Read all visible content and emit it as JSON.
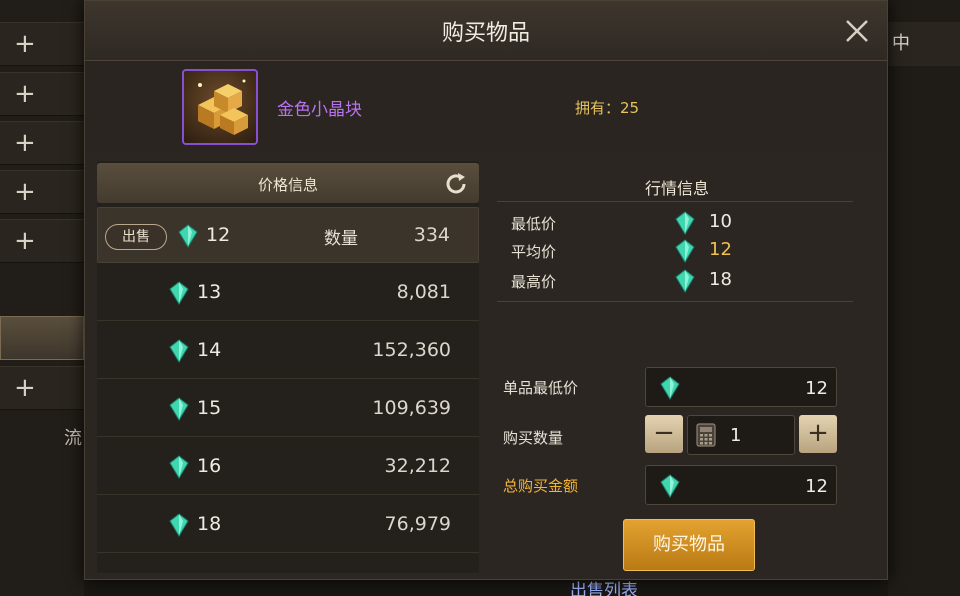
{
  "background": {
    "flow_label": "流",
    "right_tab": "中",
    "bottom_label": "出售列表"
  },
  "dialog": {
    "title": "购买物品",
    "close_icon": "close-icon"
  },
  "item": {
    "name": "金色小晶块",
    "owned": "拥有：25",
    "icon": "gold-crystal-block-icon",
    "name_color": "#b873f0"
  },
  "price_info": {
    "title": "价格信息",
    "refresh_icon": "refresh-icon",
    "selected": {
      "sell_label": "出售",
      "price": "12",
      "qty_label": "数量",
      "qty": "334"
    },
    "rows": [
      {
        "price": "13",
        "qty": "8,081"
      },
      {
        "price": "14",
        "qty": "152,360"
      },
      {
        "price": "15",
        "qty": "109,639"
      },
      {
        "price": "16",
        "qty": "32,212"
      },
      {
        "price": "18",
        "qty": "76,979"
      }
    ]
  },
  "market_info": {
    "title": "行情信息",
    "min_label": "最低价",
    "min_val": "10",
    "avg_label": "平均价",
    "avg_val": "12",
    "max_label": "最高价",
    "max_val": "18"
  },
  "purchase": {
    "unit_min_label": "单品最低价",
    "unit_min_val": "12",
    "qty_label": "购买数量",
    "qty_val": "1",
    "minus": "−",
    "plus": "+",
    "total_label": "总购买金额",
    "total_val": "12",
    "buy_button": "购买物品"
  },
  "colors": {
    "gem": "#3fd6b0",
    "accent_gold": "#f2c14e",
    "buy_button": "#d8931f"
  }
}
